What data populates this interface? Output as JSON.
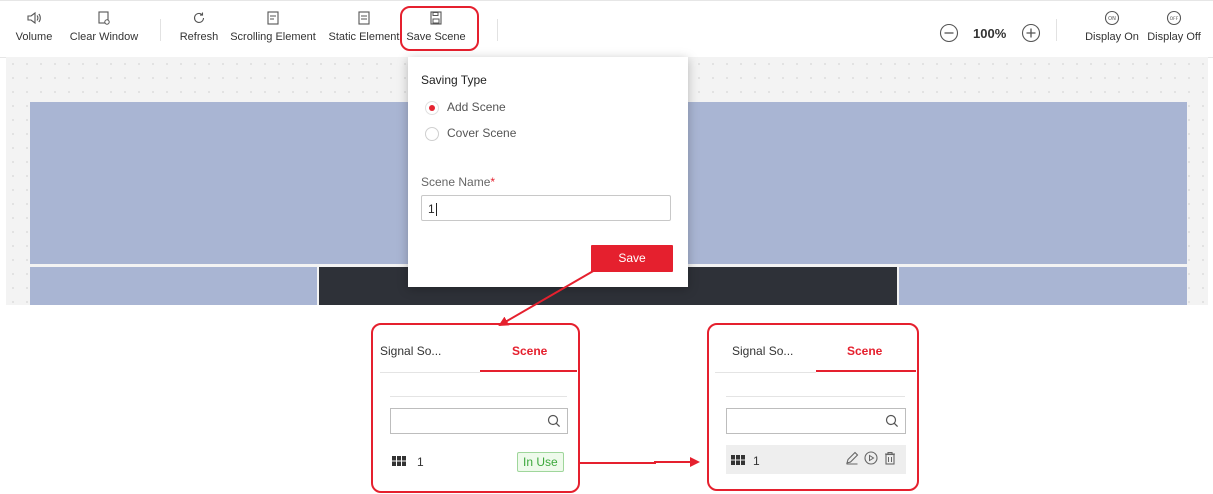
{
  "toolbar": {
    "volume": "Volume",
    "clear_window": "Clear Window",
    "refresh": "Refresh",
    "scrolling_element": "Scrolling Element",
    "static_element": "Static Element",
    "save_scene": "Save Scene",
    "zoom": "100%",
    "display_on": "Display On",
    "display_off": "Display Off"
  },
  "popup": {
    "title": "Saving Type",
    "option_add": "Add Scene",
    "option_cover": "Cover Scene",
    "selected": "Add Scene",
    "name_label": "Scene Name",
    "required_mark": "*",
    "name_value": "1",
    "save_label": "Save"
  },
  "panel_before": {
    "tab_signal": "Signal So...",
    "tab_scene": "Scene",
    "scene_name": "1",
    "status": "In Use"
  },
  "panel_after": {
    "tab_signal": "Signal So...",
    "tab_scene": "Scene",
    "scene_name": "1"
  },
  "colors": {
    "accent": "#e5202e",
    "screen_block": "#a9b5d3",
    "dark_block": "#2e3138",
    "in_use_green": "#3ca83c"
  }
}
